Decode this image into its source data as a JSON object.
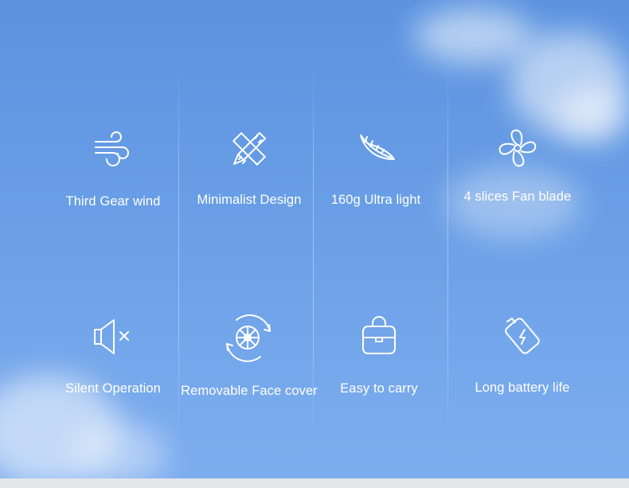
{
  "features": [
    {
      "icon": "wind-icon",
      "label": "Third Gear wind"
    },
    {
      "icon": "ruler-pencil-icon",
      "label": "Minimalist Design"
    },
    {
      "icon": "feather-icon",
      "label": "160g Ultra light"
    },
    {
      "icon": "fan-blade-icon",
      "label": "4 slices Fan blade"
    },
    {
      "icon": "speaker-mute-icon",
      "label": "Silent Operation"
    },
    {
      "icon": "rotate-fan-cover-icon",
      "label": "Removable Face cover"
    },
    {
      "icon": "bag-icon",
      "label": "Easy to carry"
    },
    {
      "icon": "battery-charge-icon",
      "label": "Long battery life"
    }
  ],
  "colors": {
    "sky_top": "#5b93e0",
    "sky_bottom": "#7eaef0",
    "text": "#ffffff"
  }
}
